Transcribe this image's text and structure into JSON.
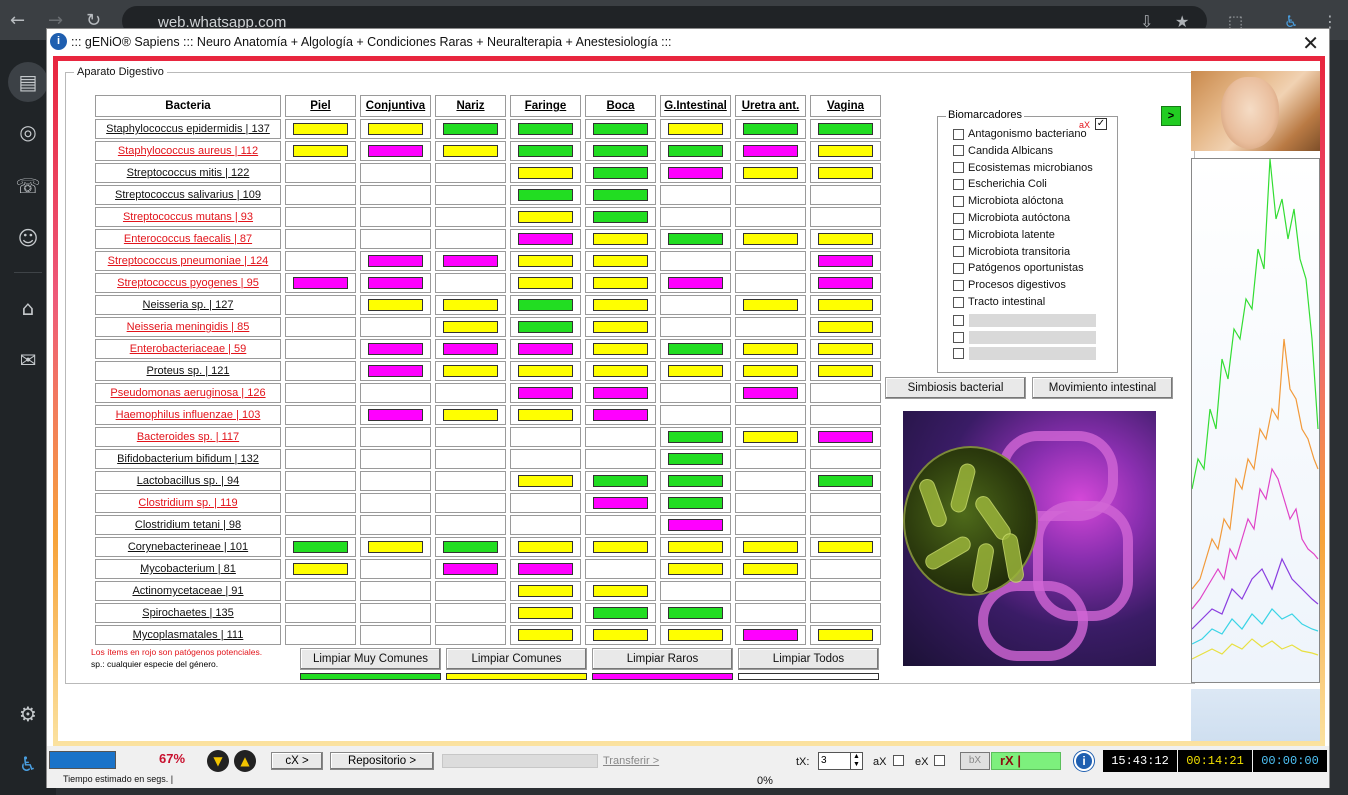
{
  "browser": {
    "url": "web.whatsapp.com"
  },
  "window": {
    "title": "::: gENiO® Sapiens ::: Neuro Anatomía + Algología + Condiciones Raras + Neuralterapia + Anestesiología :::",
    "close_glyph": "✕",
    "logo_glyph": "i"
  },
  "group_title": "Aparato Digestivo",
  "table": {
    "header_bacteria": "Bacteria",
    "columns": [
      "Piel",
      "Conjuntiva",
      "Nariz",
      "Faringe",
      "Boca",
      "G.Intestinal",
      "Uretra ant.",
      "Vagina"
    ],
    "rows": [
      {
        "name": "Staphylococcus epidermidis | 137",
        "red": false,
        "cells": [
          "y",
          "y",
          "g",
          "g",
          "g",
          "y",
          "g",
          "g"
        ]
      },
      {
        "name": "Staphylococcus aureus | 112",
        "red": true,
        "cells": [
          "y",
          "m",
          "y",
          "g",
          "g",
          "g",
          "m",
          "y"
        ]
      },
      {
        "name": "Streptococcus mitis | 122",
        "red": false,
        "cells": [
          "",
          "",
          "",
          "y",
          "g",
          "m",
          "y",
          "y"
        ]
      },
      {
        "name": "Streptococcus salivarius | 109",
        "red": false,
        "cells": [
          "",
          "",
          "",
          "g",
          "g",
          "",
          "",
          ""
        ]
      },
      {
        "name": "Streptococcus mutans | 93",
        "red": true,
        "cells": [
          "",
          "",
          "",
          "y",
          "g",
          "",
          "",
          ""
        ]
      },
      {
        "name": "Enterococcus faecalis | 87",
        "red": true,
        "cells": [
          "",
          "",
          "",
          "m",
          "y",
          "g",
          "y",
          "y"
        ]
      },
      {
        "name": "Streptococcus pneumoniae | 124",
        "red": true,
        "cells": [
          "",
          "m",
          "m",
          "y",
          "y",
          "",
          "",
          "m"
        ]
      },
      {
        "name": "Streptococcus pyogenes | 95",
        "red": true,
        "cells": [
          "m",
          "m",
          "",
          "y",
          "y",
          "m",
          "",
          "m"
        ]
      },
      {
        "name": "Neisseria sp. | 127",
        "red": false,
        "cells": [
          "",
          "y",
          "y",
          "g",
          "y",
          "",
          "y",
          "y"
        ]
      },
      {
        "name": "Neisseria meningidis | 85",
        "red": true,
        "cells": [
          "",
          "",
          "y",
          "g",
          "y",
          "",
          "",
          "y"
        ]
      },
      {
        "name": "Enterobacteriaceae | 59",
        "red": true,
        "cells": [
          "",
          "m",
          "m",
          "m",
          "y",
          "g",
          "y",
          "y"
        ]
      },
      {
        "name": "Proteus sp. | 121",
        "red": false,
        "cells": [
          "",
          "m",
          "y",
          "y",
          "y",
          "y",
          "y",
          "y"
        ]
      },
      {
        "name": "Pseudomonas aeruginosa | 126",
        "red": true,
        "cells": [
          "",
          "",
          "",
          "m",
          "m",
          "",
          "m",
          ""
        ]
      },
      {
        "name": "Haemophilus influenzae | 103",
        "red": true,
        "cells": [
          "",
          "m",
          "y",
          "y",
          "m",
          "",
          "",
          ""
        ]
      },
      {
        "name": "Bacteroides sp. | 117",
        "red": true,
        "cells": [
          "",
          "",
          "",
          "",
          "",
          "g",
          "y",
          "m"
        ]
      },
      {
        "name": "Bifidobacterium bifidum | 132",
        "red": false,
        "cells": [
          "",
          "",
          "",
          "",
          "",
          "g",
          "",
          ""
        ]
      },
      {
        "name": "Lactobacillus sp. | 94",
        "red": false,
        "cells": [
          "",
          "",
          "",
          "y",
          "g",
          "g",
          "",
          "g"
        ]
      },
      {
        "name": "Clostridium sp. | 119",
        "red": true,
        "cells": [
          "",
          "",
          "",
          "",
          "m",
          "g",
          "",
          ""
        ]
      },
      {
        "name": "Clostridium tetani | 98",
        "red": false,
        "cells": [
          "",
          "",
          "",
          "",
          "",
          "m",
          "",
          ""
        ]
      },
      {
        "name": "Corynebacterineae | 101",
        "red": false,
        "cells": [
          "g",
          "y",
          "g",
          "y",
          "y",
          "y",
          "y",
          "y"
        ]
      },
      {
        "name": "Mycobacterium | 81",
        "red": false,
        "cells": [
          "y",
          "",
          "m",
          "m",
          "",
          "y",
          "y",
          ""
        ]
      },
      {
        "name": "Actinomycetaceae | 91",
        "red": false,
        "cells": [
          "",
          "",
          "",
          "y",
          "y",
          "",
          "",
          ""
        ]
      },
      {
        "name": "Spirochaetes | 135",
        "red": false,
        "cells": [
          "",
          "",
          "",
          "y",
          "g",
          "g",
          "",
          ""
        ]
      },
      {
        "name": "Mycoplasmatales | 111",
        "red": false,
        "cells": [
          "",
          "",
          "",
          "y",
          "y",
          "y",
          "m",
          "y"
        ]
      }
    ]
  },
  "colors": {
    "g": "#22dd22",
    "y": "#ffff00",
    "m": "#ff00ff",
    "empty": "#ffffff"
  },
  "notes": {
    "line1": "Los ítems en rojo son patógenos potenciales.",
    "line2": "sp.: cualquier especie del género."
  },
  "clear_buttons": [
    "Limpiar Muy Comunes",
    "Limpiar Comunes",
    "Limpiar Raros",
    "Limpiar Todos"
  ],
  "biomarkers": {
    "title": "Biomarcadores",
    "ax_label": "aX",
    "ax_checked_glyph": "✓",
    "items": [
      "Antagonismo bacteriano",
      "Candida Albicans",
      "Ecosistemas microbianos",
      "Escherichia Coli",
      "Microbiota alóctona",
      "Microbiota autóctona",
      "Microbiota latente",
      "Microbiota transitoria",
      "Patógenos oportunistas",
      "Procesos digestivos",
      "Tracto intestinal"
    ],
    "empty_slots": 3
  },
  "go_button": ">",
  "action_buttons": [
    "Simbiosis bacterial",
    "Movimiento intestinal"
  ],
  "status": {
    "progress_pct": "67%",
    "progress_fraction": 0.67,
    "estimated_label": "Tiempo estimado en segs.  |",
    "down_glyph": "▼",
    "up_glyph": "▲",
    "cx_button": "cX >",
    "repo_button": "Repositorio >",
    "transfer_link": "Transferir >",
    "transfer_pct": "0%",
    "tx_label": "tX:",
    "tx_value": "3",
    "ax_label": "aX",
    "ex_label": "eX",
    "bx_label": "bX",
    "rx_label": "rX |",
    "clock1": "15:43:12",
    "clock2": "00:14:21",
    "clock3": "00:00:00"
  }
}
